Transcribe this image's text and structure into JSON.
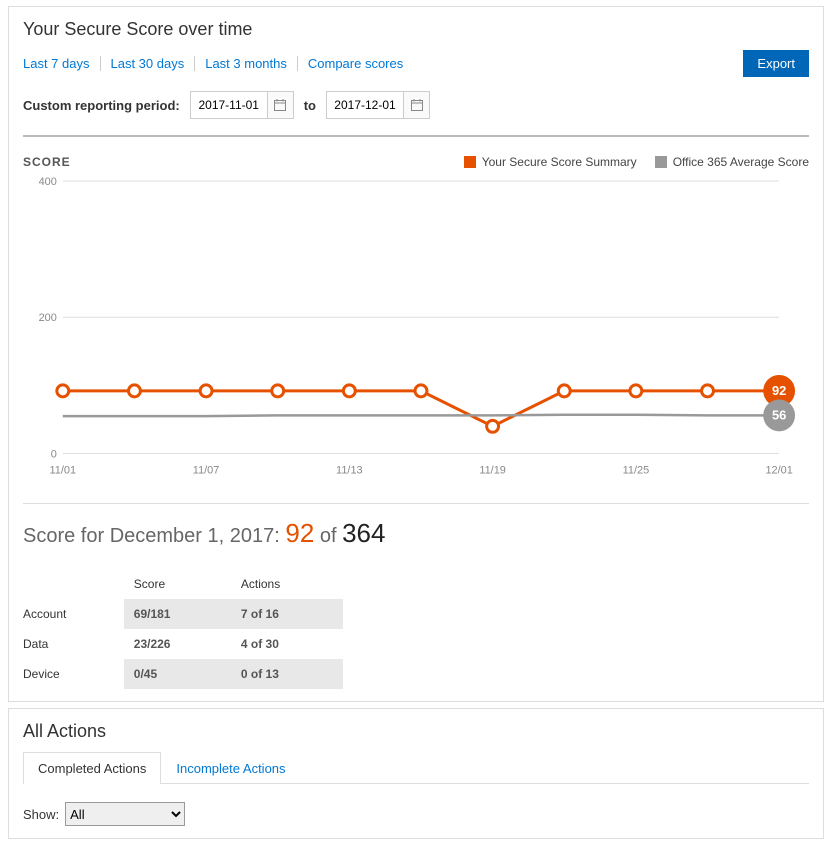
{
  "header": {
    "title": "Your Secure Score over time",
    "range_links": [
      "Last 7 days",
      "Last 30 days",
      "Last 3 months",
      "Compare scores"
    ],
    "export_label": "Export",
    "custom_label": "Custom reporting period:",
    "date_from": "2017-11-01",
    "to_label": "to",
    "date_to": "2017-12-01"
  },
  "chart_data": {
    "type": "line",
    "title": "SCORE",
    "ylabel": "",
    "xlabel": "",
    "ylim": [
      0,
      400
    ],
    "yticks": [
      0,
      200,
      400
    ],
    "categories": [
      "11/01",
      "11/04",
      "11/07",
      "11/10",
      "11/13",
      "11/16",
      "11/19",
      "11/22",
      "11/25",
      "11/28",
      "12/01"
    ],
    "xticks_shown": [
      "11/01",
      "11/07",
      "11/13",
      "11/19",
      "11/25",
      "12/01"
    ],
    "series": [
      {
        "name": "Your Secure Score Summary",
        "color": "#e65100",
        "values": [
          92,
          92,
          92,
          92,
          92,
          92,
          40,
          92,
          92,
          92,
          92
        ],
        "marker": "o",
        "end_label": "92"
      },
      {
        "name": "Office 365 Average Score",
        "color": "#999999",
        "values": [
          55,
          55,
          55,
          56,
          56,
          56,
          56,
          57,
          57,
          56,
          56
        ],
        "marker": "none",
        "end_label": "56"
      }
    ],
    "legend": [
      "Your Secure Score Summary",
      "Office 365 Average Score"
    ]
  },
  "score_summary": {
    "label_prefix": "Score for December 1, 2017: ",
    "score": "92",
    "of_word": " of ",
    "max": "364"
  },
  "breakdown": {
    "columns": [
      "",
      "Score",
      "Actions"
    ],
    "rows": [
      {
        "label": "Account",
        "score": "69/181",
        "actions": "7 of 16",
        "striped": true
      },
      {
        "label": "Data",
        "score": "23/226",
        "actions": "4 of 30",
        "striped": false
      },
      {
        "label": "Device",
        "score": "0/45",
        "actions": "0 of 13",
        "striped": true
      }
    ]
  },
  "all_actions": {
    "title": "All Actions",
    "tabs": [
      "Completed Actions",
      "Incomplete Actions"
    ],
    "active_tab": 0,
    "show_label": "Show:",
    "show_options": [
      "All"
    ],
    "show_selected": "All"
  }
}
